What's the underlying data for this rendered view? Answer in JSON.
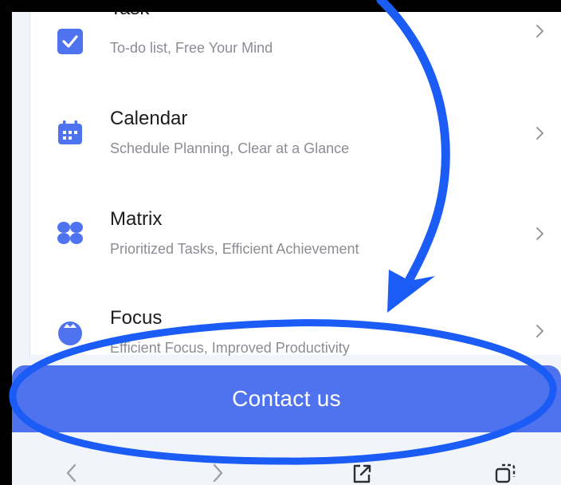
{
  "menu": {
    "items": [
      {
        "title": "Task",
        "subtitle": "To-do list, Free Your Mind",
        "icon": "checkbox-icon"
      },
      {
        "title": "Calendar",
        "subtitle": "Schedule Planning, Clear at a Glance",
        "icon": "calendar-icon"
      },
      {
        "title": "Matrix",
        "subtitle": "Prioritized Tasks, Efficient Achievement",
        "icon": "matrix-icon"
      },
      {
        "title": "Focus",
        "subtitle": "Efficient Focus, Improved Productivity",
        "icon": "focus-icon"
      }
    ]
  },
  "contact": {
    "label": "Contact us"
  },
  "colors": {
    "accent": "#4f73ee",
    "annotation": "#1a5cf5",
    "background": "#f1f4fb"
  },
  "browser_nav": {
    "icons": [
      "back-icon",
      "forward-icon",
      "share-icon",
      "tabs-icon"
    ]
  }
}
